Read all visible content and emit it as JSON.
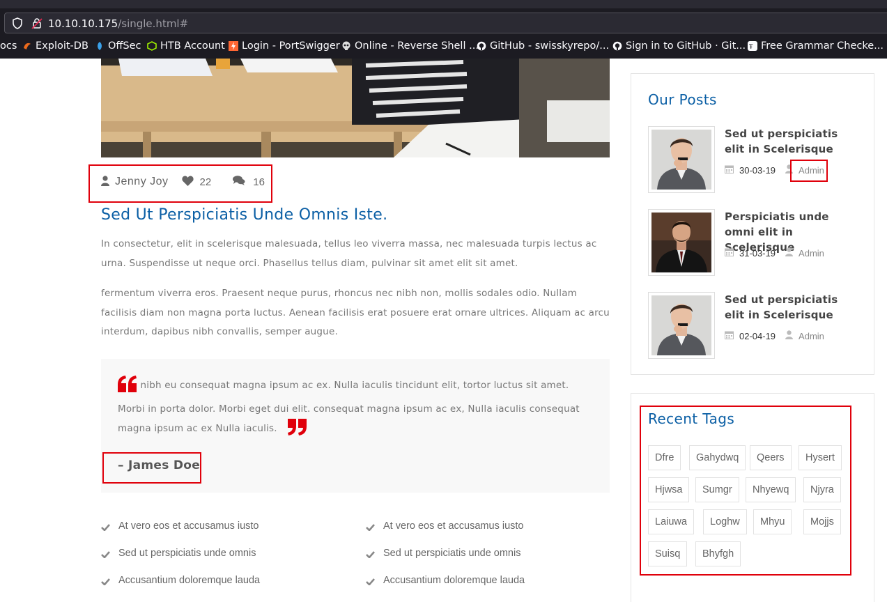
{
  "browser": {
    "url_host": "10.10.10.175",
    "url_path": "/single.html#",
    "bookmarks": [
      {
        "label": "ocs",
        "icon": "bookmark-icon"
      },
      {
        "label": "Exploit-DB",
        "icon": "exploitdb-icon"
      },
      {
        "label": "OffSec",
        "icon": "offsec-icon"
      },
      {
        "label": "HTB Account",
        "icon": "htb-icon"
      },
      {
        "label": "Login - PortSwigger",
        "icon": "portswigger-icon"
      },
      {
        "label": "Online - Reverse Shell ...",
        "icon": "skull-icon"
      },
      {
        "label": "GitHub - swisskyrepo/...",
        "icon": "github-icon"
      },
      {
        "label": "Sign in to GitHub · Git...",
        "icon": "github-icon"
      },
      {
        "label": "Free Grammar Checke...",
        "icon": "grammar-icon"
      }
    ]
  },
  "post": {
    "author": "Jenny Joy",
    "likes": "22",
    "comments": "16",
    "title": "Sed Ut Perspiciatis Unde Omnis Iste.",
    "para1": "In consectetur, elit in scelerisque malesuada, tellus leo viverra massa, nec malesuada turpis lectus ac urna. Suspendisse ut neque orci. Phasellus tellus diam, pulvinar sit amet elit sit amet.",
    "para2": "fermentum viverra eros. Praesent neque purus, rhoncus nec nibh non, mollis sodales odio. Nullam facilisis diam non magna porta luctus. Aenean facilisis erat posuere erat ornare ultrices. Aliquam ac arcu interdum, dapibus nibh convallis, semper augue.",
    "quote": "nibh eu consequat magna ipsum ac ex. Nulla iaculis tincidunt elit, tortor luctus sit amet. Morbi in porta dolor. Morbi eget dui elit. consequat magna ipsum ac ex, Nulla iaculis consequat magna ipsum ac ex Nulla iaculis.",
    "quote_author": "– James Doe",
    "checklist_left": [
      "At vero eos et accusamus iusto",
      "Sed ut perspiciatis unde omnis",
      "Accusantium doloremque lauda"
    ],
    "checklist_right": [
      "At vero eos et accusamus iusto",
      "Sed ut perspiciatis unde omnis",
      "Accusantium doloremque lauda"
    ]
  },
  "sidebar": {
    "our_posts_title": "Our Posts",
    "posts": [
      {
        "title": "Sed ut perspiciatis elit in Scelerisque",
        "date": "30-03-19",
        "author": "Admin"
      },
      {
        "title": "Perspiciatis unde omni elit in Scelerisque",
        "date": "31-03-19",
        "author": "Admin"
      },
      {
        "title": "Sed ut perspiciatis elit in Scelerisque",
        "date": "02-04-19",
        "author": "Admin"
      }
    ],
    "tags_title": "Recent Tags",
    "tags": [
      "Dfre",
      "Gahydwq",
      "Qeers",
      "Hysert",
      "Hjwsa",
      "Sumgr",
      "Nhyewq",
      "Njyra",
      "Laiuwa",
      "Loghw",
      "Mhyu",
      "Mojjs",
      "Suisq",
      "Bhyfgh"
    ]
  },
  "colors": {
    "accent_blue": "#0b5fa5",
    "highlight_red": "#e0000b",
    "quote_red": "#e0000b"
  }
}
